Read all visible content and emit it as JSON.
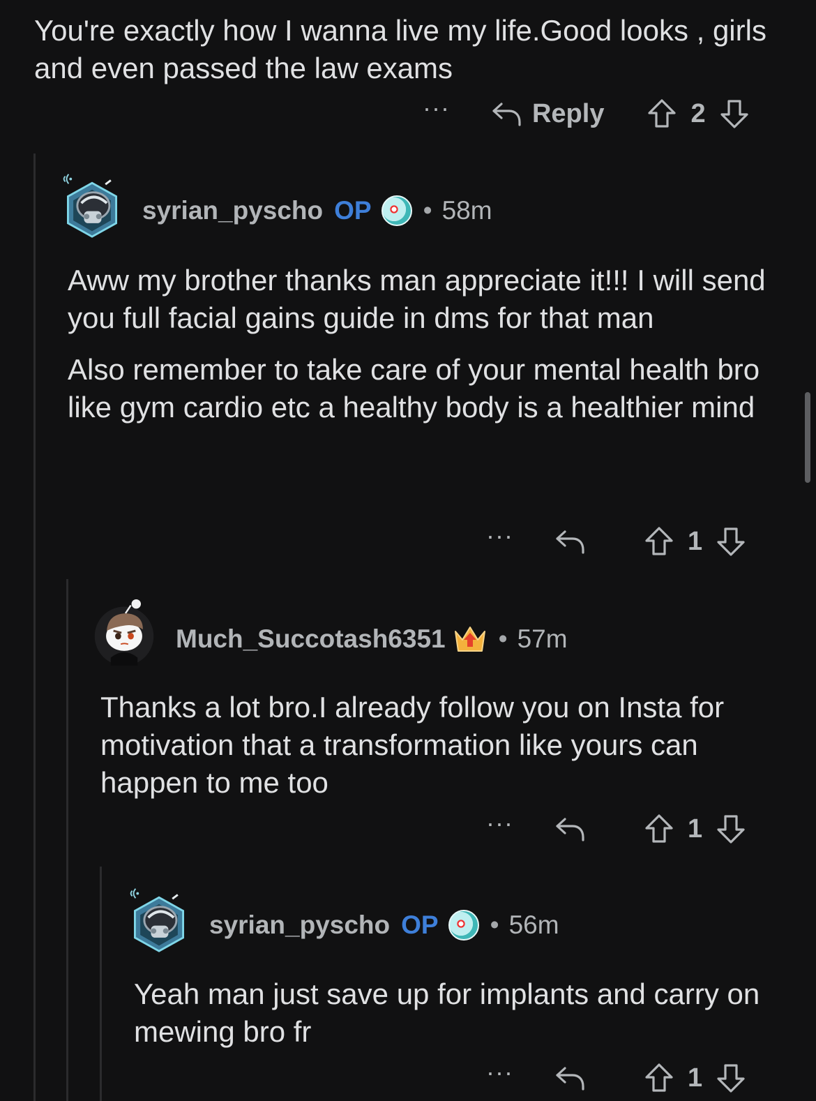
{
  "comments": [
    {
      "paragraphs": [
        "You're exactly how I wanna live my life.Good looks , girls and even passed the law exams"
      ],
      "actions": {
        "more": "···",
        "reply": "Reply",
        "score": "2"
      }
    },
    {
      "username": "syrian_pyscho",
      "op_badge": "OP",
      "separator": "•",
      "age": "58m",
      "paragraphs": [
        "Aww my brother thanks man appreciate it!!! I will send you full facial gains guide in dms for that man",
        "Also remember to take care of your mental health bro like gym cardio etc a healthy body is a healthier mind"
      ],
      "actions": {
        "more": "···",
        "score": "1"
      }
    },
    {
      "username": "Much_Succotash6351",
      "separator": "•",
      "age": "57m",
      "paragraphs": [
        "Thanks a lot bro.I already follow you on Insta for motivation that a transformation like yours can happen to me too"
      ],
      "actions": {
        "more": "···",
        "score": "1"
      }
    },
    {
      "username": "syrian_pyscho",
      "op_badge": "OP",
      "separator": "•",
      "age": "56m",
      "paragraphs": [
        "Yeah man just save up for implants and carry on mewing bro fr"
      ],
      "actions": {
        "more": "···",
        "score": "1"
      }
    }
  ],
  "colors": {
    "background": "#111112",
    "op": "#3e7fd9",
    "thread_line": "#2b2b2d"
  },
  "icons": [
    "more-icon",
    "reply-arrow-icon",
    "upvote-icon",
    "downvote-icon",
    "flair-icon",
    "trophy-crown-icon"
  ]
}
